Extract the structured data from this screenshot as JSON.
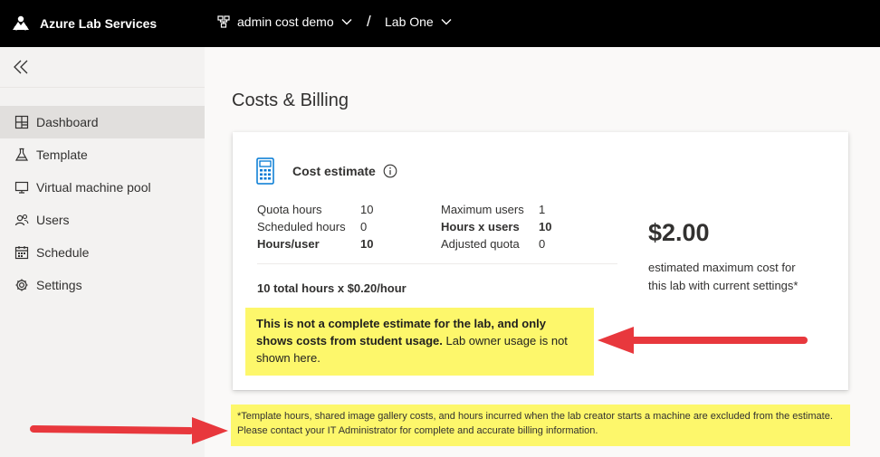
{
  "app": {
    "title": "Azure Lab Services"
  },
  "breadcrumb": {
    "workspace": "admin cost demo",
    "separator": "/",
    "lab": "Lab One"
  },
  "sidebar": {
    "items": [
      {
        "label": "Dashboard",
        "icon": "dashboard-icon",
        "active": true
      },
      {
        "label": "Template",
        "icon": "flask-icon"
      },
      {
        "label": "Virtual machine pool",
        "icon": "monitor-icon"
      },
      {
        "label": "Users",
        "icon": "users-icon"
      },
      {
        "label": "Schedule",
        "icon": "calendar-icon"
      },
      {
        "label": "Settings",
        "icon": "gear-icon"
      }
    ]
  },
  "page": {
    "title": "Costs & Billing"
  },
  "card": {
    "title": "Cost estimate",
    "left": [
      {
        "label": "Quota hours",
        "value": "10",
        "bold": false
      },
      {
        "label": "Scheduled hours",
        "value": "0",
        "bold": false
      },
      {
        "label": "Hours/user",
        "value": "10",
        "bold": true
      }
    ],
    "right": [
      {
        "label": "Maximum users",
        "value": "1",
        "bold": false
      },
      {
        "label": "Hours x users",
        "value": "10",
        "bold": true
      },
      {
        "label": "Adjusted quota",
        "value": "0",
        "bold": false
      }
    ],
    "formula": "10 total hours x $0.20/hour",
    "price": "$2.00",
    "price_desc": "estimated maximum cost for this lab with current settings*"
  },
  "note1": {
    "bold_text": "This is not a complete estimate for the lab, and only shows costs from student usage.",
    "text": " Lab owner usage is not shown here."
  },
  "note2": {
    "text": "*Template hours, shared image gallery costs, and hours incurred when the lab creator starts a machine are excluded from the estimate. Please contact your IT Administrator for complete and accurate billing information."
  },
  "colors": {
    "topbar": "#000000",
    "highlight": "#fdf76b",
    "arrow": "#e8383d",
    "icon_blue": "#0078d4"
  }
}
